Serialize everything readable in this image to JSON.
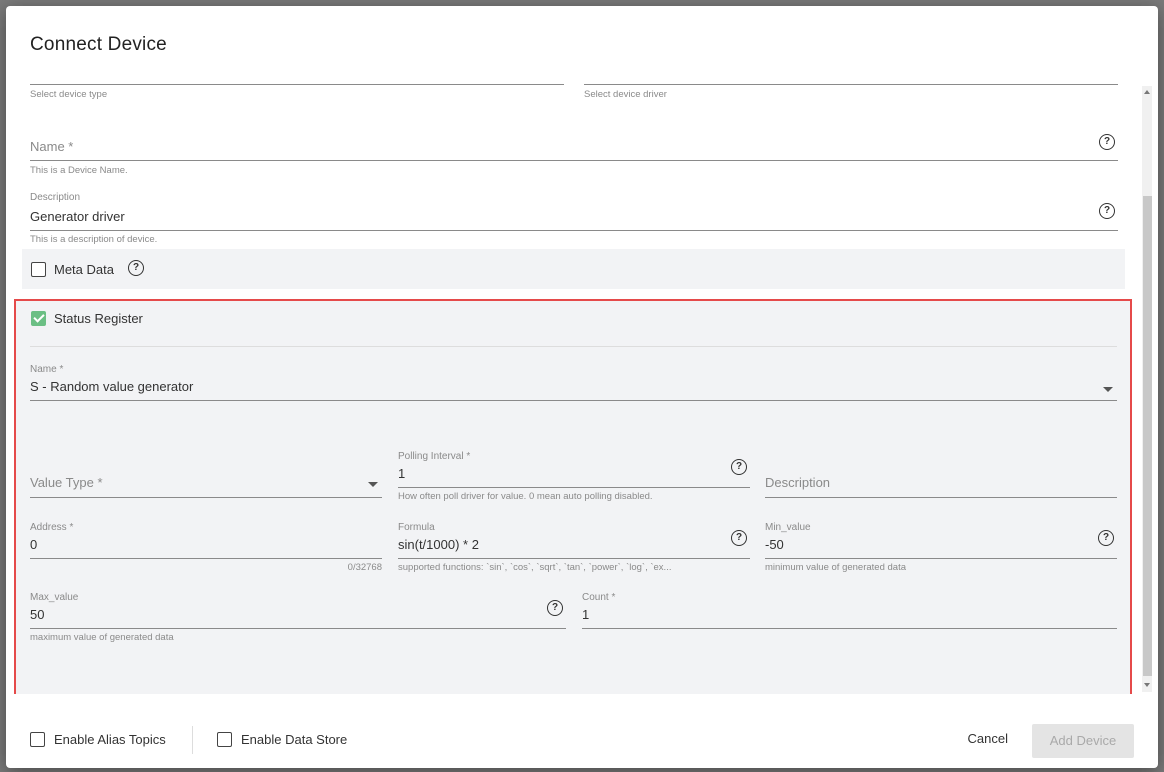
{
  "dialog": {
    "title": "Connect Device"
  },
  "device_type": {
    "hint": "Select device type"
  },
  "device_driver": {
    "hint": "Select device driver"
  },
  "name": {
    "label": "Name *",
    "hint": "This is a Device Name."
  },
  "description": {
    "label": "Description",
    "value": "Generator driver",
    "hint": "This is a description of device."
  },
  "meta_data": {
    "label": "Meta Data",
    "checked": false
  },
  "status_register": {
    "label": "Status Register",
    "checked": true,
    "name": {
      "label": "Name *",
      "value": "S - Random value generator"
    },
    "value_type": {
      "label": "Value Type *"
    },
    "polling_interval": {
      "label": "Polling Interval *",
      "value": "1",
      "hint": "How often poll driver for value. 0 mean auto polling disabled."
    },
    "description": {
      "label": "Description"
    },
    "address": {
      "label": "Address *",
      "value": "0",
      "counter": "0/32768"
    },
    "formula": {
      "label": "Formula",
      "value": "sin(t/1000) * 2",
      "hint": "supported functions: `sin`, `cos`, `sqrt`, `tan`, `power`, `log`, `ex..."
    },
    "min_value": {
      "label": "Min_value",
      "value": "-50",
      "hint": "minimum value of generated data"
    },
    "max_value": {
      "label": "Max_value",
      "value": "50",
      "hint": "maximum value of generated data"
    },
    "count": {
      "label": "Count *",
      "value": "1"
    }
  },
  "footer": {
    "enable_alias_topics": "Enable Alias Topics",
    "enable_data_store": "Enable Data Store",
    "cancel": "Cancel",
    "add_device": "Add Device"
  },
  "icons": {
    "help": "?",
    "help_icon": "question-circle-icon",
    "dropdown_icon": "chevron-down-icon",
    "check_icon": "checkmark-icon"
  },
  "colors": {
    "checkbox_checked": "#6bbf84",
    "highlight_border": "#e54a4a",
    "panel_bg": "#f2f3f5",
    "disabled_button_bg": "#e4e4e4"
  }
}
